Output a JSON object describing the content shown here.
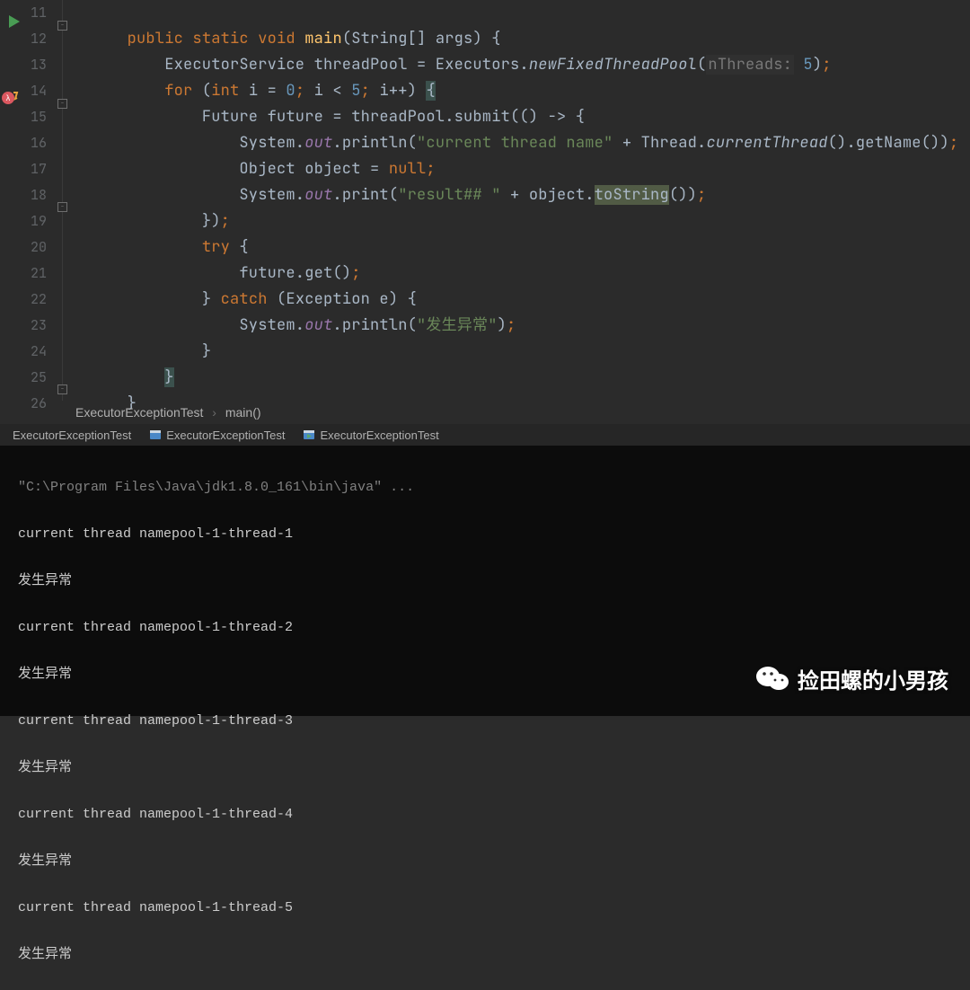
{
  "gutter": {
    "start": 11,
    "lines": [
      "11",
      "12",
      "13",
      "14",
      "15",
      "16",
      "17",
      "18",
      "19",
      "20",
      "21",
      "22",
      "23",
      "24",
      "25",
      "26"
    ]
  },
  "code": {
    "l12": {
      "kw1": "public",
      "kw2": "static",
      "kw3": "void",
      "m": "main",
      "args": "(String[] args) {"
    },
    "l13": {
      "a": "ExecutorService threadPool = Executors.",
      "b": "newFixedThreadPool",
      "c": "(",
      "hint": "nThreads:",
      "d": " 5",
      "e": ")",
      "semi": ";"
    },
    "l14": {
      "kw": "for",
      "p1": " (",
      "t": "int",
      "p2": " i = ",
      "n0": "0",
      "s1": ";",
      " p3": " i < ",
      "n1": "5",
      "s2": ";",
      " p4": " i++) ",
      "br": "{"
    },
    "l15": {
      "a": "Future future = threadPool.submit(() -> {"
    },
    "l16": {
      "a": "System.",
      "out": "out",
      "b": ".println(",
      "s": "\"current thread name\"",
      "c": " + Thread.",
      "it": "currentThread",
      "d": "().getName())",
      "semi": ";"
    },
    "l17": {
      "a": "Object object = ",
      "kw": "null",
      "semi": ";"
    },
    "l18": {
      "a": "System.",
      "out": "out",
      "b": ".print(",
      "s": "\"result## \"",
      "c": " + object.",
      "hi": "toString",
      "d": "())",
      "semi": ";"
    },
    "l19": {
      "a": "})",
      "semi": ";"
    },
    "l20": {
      "kw": "try",
      "b": " {"
    },
    "l21": {
      "a": "future.get()",
      "semi": ";"
    },
    "l22": {
      "a": "} ",
      "kw": "catch",
      "b": " (Exception e) {"
    },
    "l23": {
      "a": "System.",
      "out": "out",
      "b": ".println(",
      "s": "\"发生异常\"",
      "c": ")",
      "semi": ";"
    },
    "l24": {
      "a": "}"
    },
    "l25": {
      "a": "}"
    },
    "l26": {
      "a": "}"
    }
  },
  "breadcrumb": {
    "a": "ExecutorExceptionTest",
    "b": "main()"
  },
  "tabs": {
    "t1": "ExecutorExceptionTest",
    "t2": "ExecutorExceptionTest",
    "t3": "ExecutorExceptionTest"
  },
  "console": [
    "\"C:\\Program Files\\Java\\jdk1.8.0_161\\bin\\java\" ...",
    "current thread namepool-1-thread-1",
    "发生异常",
    "current thread namepool-1-thread-2",
    "发生异常",
    "current thread namepool-1-thread-3",
    "发生异常",
    "current thread namepool-1-thread-4",
    "发生异常",
    "current thread namepool-1-thread-5",
    "发生异常"
  ],
  "watermark": "捡田螺的小男孩"
}
